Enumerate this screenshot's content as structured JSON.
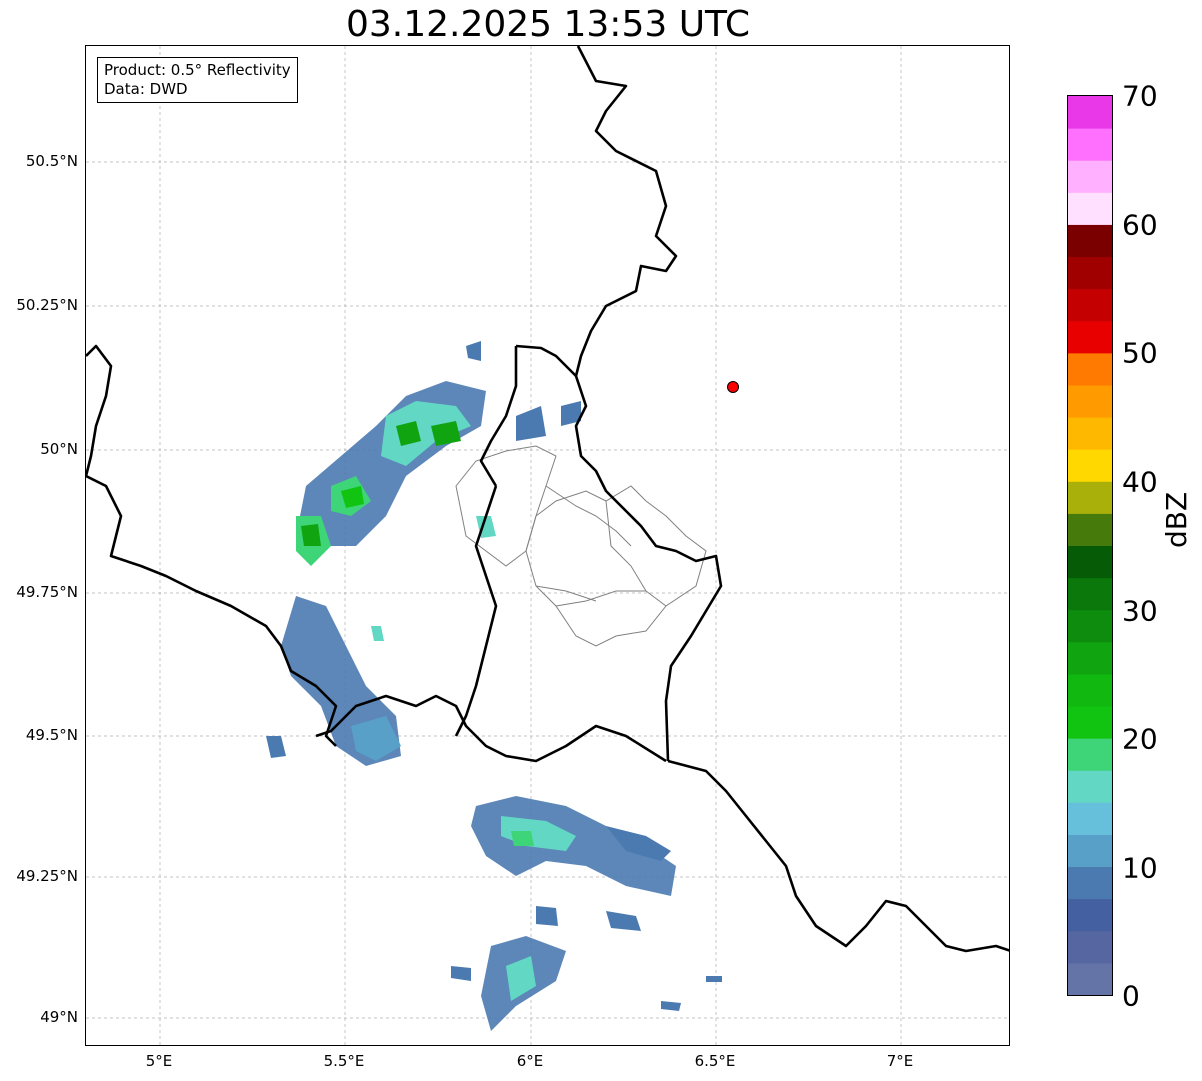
{
  "title": "03.12.2025 13:53 UTC",
  "infobox": {
    "product": "Product: 0.5° Reflectivity",
    "data": "Data: DWD"
  },
  "lat_ticks": [
    "50.5°N",
    "50.25°N",
    "50°N",
    "49.75°N",
    "49.5°N",
    "49.25°N",
    "49°N"
  ],
  "lon_ticks": [
    "5°E",
    "5.5°E",
    "6°E",
    "6.5°E",
    "7°E"
  ],
  "colorbar": {
    "label": "dBZ",
    "ticks": [
      "0",
      "10",
      "20",
      "30",
      "40",
      "50",
      "60",
      "70"
    ],
    "colors": [
      "#6474a6",
      "#5566a0",
      "#4460a0",
      "#4a7ab0",
      "#58a0c8",
      "#66c0dc",
      "#62d8c4",
      "#3ed478",
      "#12c412",
      "#10b810",
      "#10a410",
      "#0e8c0e",
      "#0a780a",
      "#065c06",
      "#467a0a",
      "#aab00a",
      "#ffd800",
      "#ffb800",
      "#ff9a00",
      "#ff7a00",
      "#e80000",
      "#c40000",
      "#a00000",
      "#7a0000",
      "#ffe0ff",
      "#ffb0ff",
      "#ff70ff",
      "#e838e8"
    ]
  },
  "station_marker": {
    "lon": 6.55,
    "lat": 50.11,
    "color": "#ff0000"
  },
  "borders": {
    "country_color": "#000000",
    "region_color": "#808080"
  }
}
